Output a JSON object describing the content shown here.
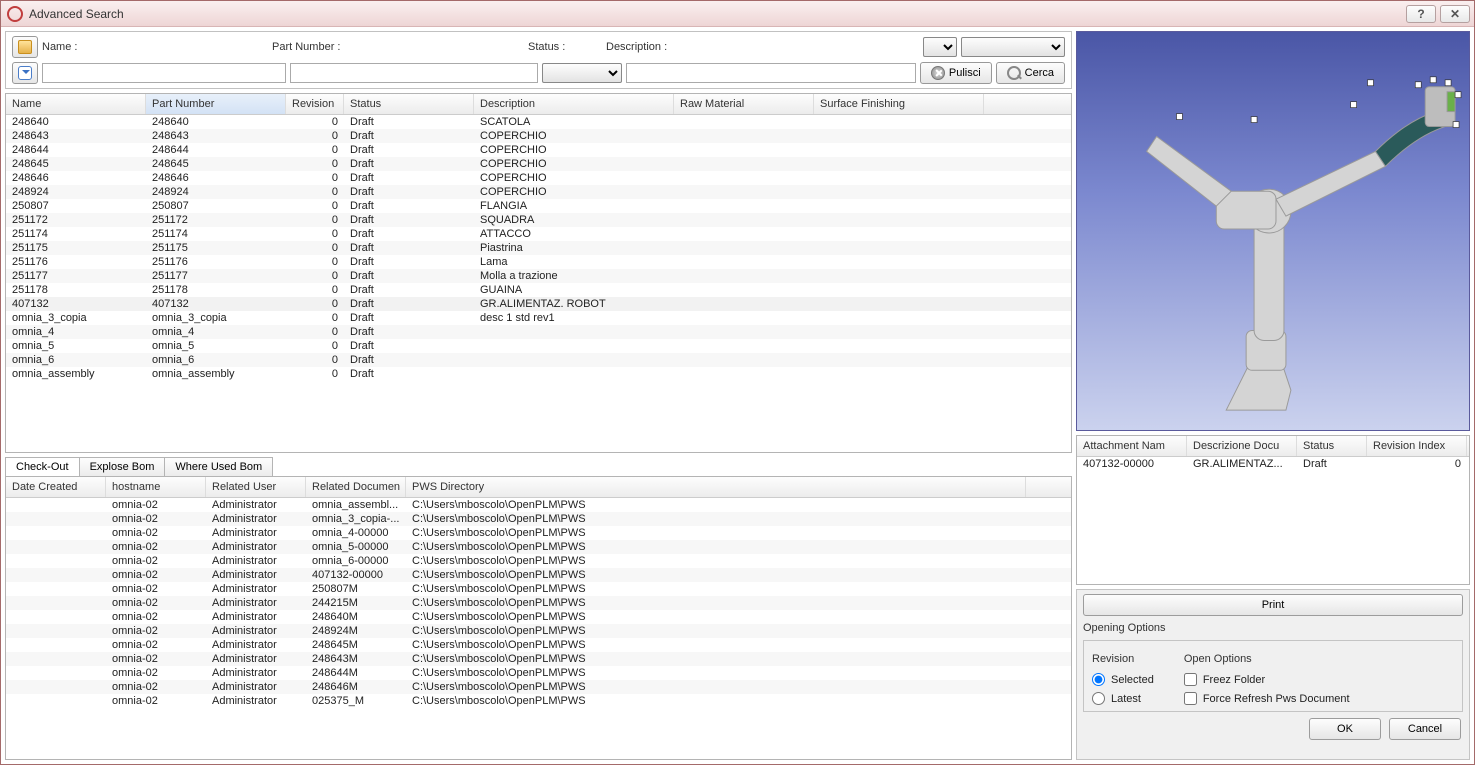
{
  "window": {
    "title": "Advanced Search"
  },
  "search": {
    "labels": {
      "name": "Name :",
      "partNumber": "Part Number :",
      "status": "Status :",
      "description": "Description :"
    },
    "buttons": {
      "clear": "Pulisci",
      "search": "Cerca"
    }
  },
  "mainTable": {
    "columns": [
      "Name",
      "Part Number",
      "Revision",
      "Status",
      "Description",
      "Raw Material",
      "Surface Finishing"
    ],
    "sortedColumn": 1,
    "rows": [
      {
        "name": "248640",
        "pn": "248640",
        "rev": "0",
        "status": "Draft",
        "desc": "SCATOLA",
        "raw": "",
        "sf": ""
      },
      {
        "name": "248643",
        "pn": "248643",
        "rev": "0",
        "status": "Draft",
        "desc": "COPERCHIO",
        "raw": "",
        "sf": ""
      },
      {
        "name": "248644",
        "pn": "248644",
        "rev": "0",
        "status": "Draft",
        "desc": "COPERCHIO",
        "raw": "",
        "sf": ""
      },
      {
        "name": "248645",
        "pn": "248645",
        "rev": "0",
        "status": "Draft",
        "desc": "COPERCHIO",
        "raw": "",
        "sf": ""
      },
      {
        "name": "248646",
        "pn": "248646",
        "rev": "0",
        "status": "Draft",
        "desc": "COPERCHIO",
        "raw": "",
        "sf": ""
      },
      {
        "name": "248924",
        "pn": "248924",
        "rev": "0",
        "status": "Draft",
        "desc": "COPERCHIO",
        "raw": "",
        "sf": ""
      },
      {
        "name": "250807",
        "pn": "250807",
        "rev": "0",
        "status": "Draft",
        "desc": "FLANGIA",
        "raw": "",
        "sf": ""
      },
      {
        "name": "251172",
        "pn": "251172",
        "rev": "0",
        "status": "Draft",
        "desc": "SQUADRA",
        "raw": "",
        "sf": ""
      },
      {
        "name": "251174",
        "pn": "251174",
        "rev": "0",
        "status": "Draft",
        "desc": "ATTACCO",
        "raw": "",
        "sf": ""
      },
      {
        "name": "251175",
        "pn": "251175",
        "rev": "0",
        "status": "Draft",
        "desc": "Piastrina",
        "raw": "",
        "sf": ""
      },
      {
        "name": "251176",
        "pn": "251176",
        "rev": "0",
        "status": "Draft",
        "desc": "Lama",
        "raw": "",
        "sf": ""
      },
      {
        "name": "251177",
        "pn": "251177",
        "rev": "0",
        "status": "Draft",
        "desc": "Molla a trazione",
        "raw": "",
        "sf": ""
      },
      {
        "name": "251178",
        "pn": "251178",
        "rev": "0",
        "status": "Draft",
        "desc": "GUAINA",
        "raw": "",
        "sf": ""
      },
      {
        "name": "407132",
        "pn": "407132",
        "rev": "0",
        "status": "Draft",
        "desc": "GR.ALIMENTAZ. ROBOT",
        "raw": "",
        "sf": "",
        "selected": true
      },
      {
        "name": "omnia_3_copia",
        "pn": "omnia_3_copia",
        "rev": "0",
        "status": "Draft",
        "desc": "desc 1 std rev1",
        "raw": "",
        "sf": ""
      },
      {
        "name": "omnia_4",
        "pn": "omnia_4",
        "rev": "0",
        "status": "Draft",
        "desc": "",
        "raw": "",
        "sf": ""
      },
      {
        "name": "omnia_5",
        "pn": "omnia_5",
        "rev": "0",
        "status": "Draft",
        "desc": "",
        "raw": "",
        "sf": ""
      },
      {
        "name": "omnia_6",
        "pn": "omnia_6",
        "rev": "0",
        "status": "Draft",
        "desc": "",
        "raw": "",
        "sf": ""
      },
      {
        "name": "omnia_assembly",
        "pn": "omnia_assembly",
        "rev": "0",
        "status": "Draft",
        "desc": "",
        "raw": "",
        "sf": ""
      }
    ]
  },
  "tabs": {
    "items": [
      "Check-Out",
      "Explose Bom",
      "Where Used Bom"
    ],
    "active": 0
  },
  "checkoutTable": {
    "columns": [
      "Date Created",
      "hostname",
      "Related User",
      "Related Documen",
      "PWS Directory"
    ],
    "rows": [
      {
        "date": "",
        "host": "omnia-02",
        "user": "Administrator",
        "doc": "omnia_assembl...",
        "pws": "C:\\Users\\mboscolo\\OpenPLM\\PWS"
      },
      {
        "date": "",
        "host": "omnia-02",
        "user": "Administrator",
        "doc": "omnia_3_copia-...",
        "pws": "C:\\Users\\mboscolo\\OpenPLM\\PWS"
      },
      {
        "date": "",
        "host": "omnia-02",
        "user": "Administrator",
        "doc": "omnia_4-00000",
        "pws": "C:\\Users\\mboscolo\\OpenPLM\\PWS"
      },
      {
        "date": "",
        "host": "omnia-02",
        "user": "Administrator",
        "doc": "omnia_5-00000",
        "pws": "C:\\Users\\mboscolo\\OpenPLM\\PWS"
      },
      {
        "date": "",
        "host": "omnia-02",
        "user": "Administrator",
        "doc": "omnia_6-00000",
        "pws": "C:\\Users\\mboscolo\\OpenPLM\\PWS"
      },
      {
        "date": "",
        "host": "omnia-02",
        "user": "Administrator",
        "doc": "407132-00000",
        "pws": "C:\\Users\\mboscolo\\OpenPLM\\PWS"
      },
      {
        "date": "",
        "host": "omnia-02",
        "user": "Administrator",
        "doc": "250807M",
        "pws": "C:\\Users\\mboscolo\\OpenPLM\\PWS"
      },
      {
        "date": "",
        "host": "omnia-02",
        "user": "Administrator",
        "doc": "244215M",
        "pws": "C:\\Users\\mboscolo\\OpenPLM\\PWS"
      },
      {
        "date": "",
        "host": "omnia-02",
        "user": "Administrator",
        "doc": "248640M",
        "pws": "C:\\Users\\mboscolo\\OpenPLM\\PWS"
      },
      {
        "date": "",
        "host": "omnia-02",
        "user": "Administrator",
        "doc": "248924M",
        "pws": "C:\\Users\\mboscolo\\OpenPLM\\PWS"
      },
      {
        "date": "",
        "host": "omnia-02",
        "user": "Administrator",
        "doc": "248645M",
        "pws": "C:\\Users\\mboscolo\\OpenPLM\\PWS"
      },
      {
        "date": "",
        "host": "omnia-02",
        "user": "Administrator",
        "doc": "248643M",
        "pws": "C:\\Users\\mboscolo\\OpenPLM\\PWS"
      },
      {
        "date": "",
        "host": "omnia-02",
        "user": "Administrator",
        "doc": "248644M",
        "pws": "C:\\Users\\mboscolo\\OpenPLM\\PWS"
      },
      {
        "date": "",
        "host": "omnia-02",
        "user": "Administrator",
        "doc": "248646M",
        "pws": "C:\\Users\\mboscolo\\OpenPLM\\PWS"
      },
      {
        "date": "",
        "host": "omnia-02",
        "user": "Administrator",
        "doc": "025375_M",
        "pws": "C:\\Users\\mboscolo\\OpenPLM\\PWS"
      }
    ]
  },
  "attachTable": {
    "columns": [
      "Attachment Nam",
      "Descrizione Docu",
      "Status",
      "Revision Index"
    ],
    "rows": [
      {
        "name": "407132-00000",
        "desc": "GR.ALIMENTAZ...",
        "status": "Draft",
        "rev": "0"
      }
    ]
  },
  "printBtn": "Print",
  "opening": {
    "title": "Opening Options",
    "revision": {
      "label": "Revision",
      "options": [
        "Selected",
        "Latest"
      ],
      "selected": 0
    },
    "open": {
      "label": "Open Options",
      "options": [
        "Freez Folder",
        "Force Refresh Pws Document"
      ]
    }
  },
  "dialogButtons": {
    "ok": "OK",
    "cancel": "Cancel"
  }
}
